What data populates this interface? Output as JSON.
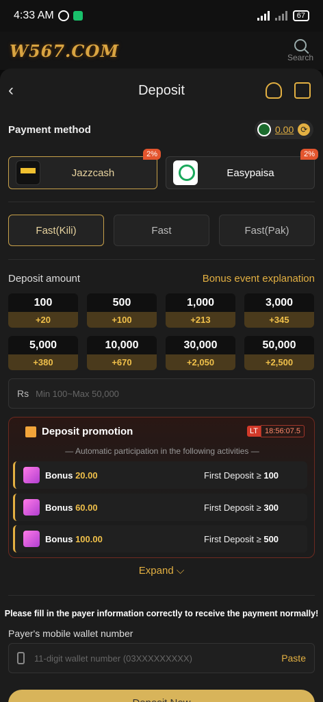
{
  "status_bar": {
    "time": "4:33 AM",
    "battery": "67"
  },
  "brand": {
    "logo_text": "W567.COM",
    "search_label": "Search"
  },
  "header": {
    "title": "Deposit"
  },
  "payment": {
    "label": "Payment method",
    "balance": "0.00",
    "methods": [
      {
        "name": "Jazzcash",
        "badge": "2%"
      },
      {
        "name": "Easypaisa",
        "badge": "2%"
      }
    ],
    "channels": [
      "Fast(Kili)",
      "Fast",
      "Fast(Pak)"
    ]
  },
  "deposit": {
    "label": "Deposit amount",
    "bonus_link": "Bonus event explanation",
    "amounts": [
      {
        "value": "100",
        "bonus": "+20"
      },
      {
        "value": "500",
        "bonus": "+100"
      },
      {
        "value": "1,000",
        "bonus": "+213"
      },
      {
        "value": "3,000",
        "bonus": "+345"
      },
      {
        "value": "5,000",
        "bonus": "+380"
      },
      {
        "value": "10,000",
        "bonus": "+670"
      },
      {
        "value": "30,000",
        "bonus": "+2,050"
      },
      {
        "value": "50,000",
        "bonus": "+2,500"
      }
    ],
    "currency_symbol": "Rs",
    "input_placeholder": "Min 100~Max 50,000"
  },
  "promotion": {
    "title": "Deposit promotion",
    "lt_tag": "LT",
    "timer": "18:56:07.5",
    "subtitle": "— Automatic participation in the following activities —",
    "rows": [
      {
        "bonus_label": "Bonus",
        "bonus": "20.00",
        "condition_label": "First Deposit ≥",
        "condition": "100"
      },
      {
        "bonus_label": "Bonus",
        "bonus": "60.00",
        "condition_label": "First Deposit ≥",
        "condition": "300"
      },
      {
        "bonus_label": "Bonus",
        "bonus": "100.00",
        "condition_label": "First Deposit ≥",
        "condition": "500"
      }
    ],
    "expand_label": "Expand ⌵"
  },
  "payer": {
    "note": "Please fill in the payer information correctly to receive the payment normally!",
    "label": "Payer's mobile wallet number",
    "placeholder": "11-digit wallet number (03XXXXXXXXX)",
    "paste": "Paste"
  },
  "cta": {
    "label": "Deposit Now"
  }
}
